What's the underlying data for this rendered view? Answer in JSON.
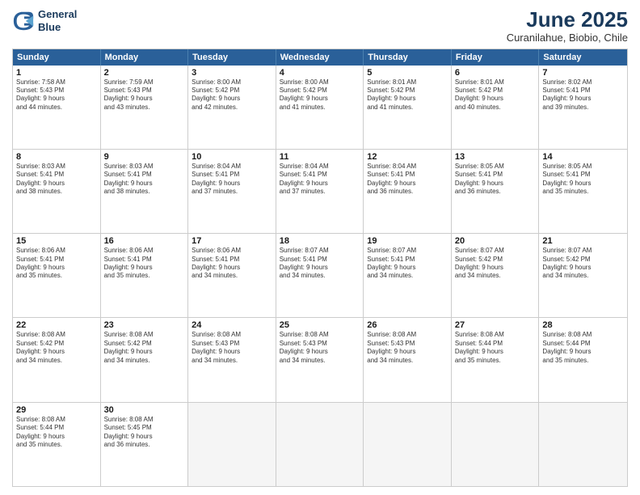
{
  "header": {
    "logo": {
      "line1": "General",
      "line2": "Blue"
    },
    "title": "June 2025",
    "subtitle": "Curanilahue, Biobio, Chile"
  },
  "days": [
    "Sunday",
    "Monday",
    "Tuesday",
    "Wednesday",
    "Thursday",
    "Friday",
    "Saturday"
  ],
  "rows": [
    [
      {
        "day": "1",
        "lines": [
          "Sunrise: 7:58 AM",
          "Sunset: 5:43 PM",
          "Daylight: 9 hours",
          "and 44 minutes."
        ]
      },
      {
        "day": "2",
        "lines": [
          "Sunrise: 7:59 AM",
          "Sunset: 5:43 PM",
          "Daylight: 9 hours",
          "and 43 minutes."
        ]
      },
      {
        "day": "3",
        "lines": [
          "Sunrise: 8:00 AM",
          "Sunset: 5:42 PM",
          "Daylight: 9 hours",
          "and 42 minutes."
        ]
      },
      {
        "day": "4",
        "lines": [
          "Sunrise: 8:00 AM",
          "Sunset: 5:42 PM",
          "Daylight: 9 hours",
          "and 41 minutes."
        ]
      },
      {
        "day": "5",
        "lines": [
          "Sunrise: 8:01 AM",
          "Sunset: 5:42 PM",
          "Daylight: 9 hours",
          "and 41 minutes."
        ]
      },
      {
        "day": "6",
        "lines": [
          "Sunrise: 8:01 AM",
          "Sunset: 5:42 PM",
          "Daylight: 9 hours",
          "and 40 minutes."
        ]
      },
      {
        "day": "7",
        "lines": [
          "Sunrise: 8:02 AM",
          "Sunset: 5:41 PM",
          "Daylight: 9 hours",
          "and 39 minutes."
        ]
      }
    ],
    [
      {
        "day": "8",
        "lines": [
          "Sunrise: 8:03 AM",
          "Sunset: 5:41 PM",
          "Daylight: 9 hours",
          "and 38 minutes."
        ]
      },
      {
        "day": "9",
        "lines": [
          "Sunrise: 8:03 AM",
          "Sunset: 5:41 PM",
          "Daylight: 9 hours",
          "and 38 minutes."
        ]
      },
      {
        "day": "10",
        "lines": [
          "Sunrise: 8:04 AM",
          "Sunset: 5:41 PM",
          "Daylight: 9 hours",
          "and 37 minutes."
        ]
      },
      {
        "day": "11",
        "lines": [
          "Sunrise: 8:04 AM",
          "Sunset: 5:41 PM",
          "Daylight: 9 hours",
          "and 37 minutes."
        ]
      },
      {
        "day": "12",
        "lines": [
          "Sunrise: 8:04 AM",
          "Sunset: 5:41 PM",
          "Daylight: 9 hours",
          "and 36 minutes."
        ]
      },
      {
        "day": "13",
        "lines": [
          "Sunrise: 8:05 AM",
          "Sunset: 5:41 PM",
          "Daylight: 9 hours",
          "and 36 minutes."
        ]
      },
      {
        "day": "14",
        "lines": [
          "Sunrise: 8:05 AM",
          "Sunset: 5:41 PM",
          "Daylight: 9 hours",
          "and 35 minutes."
        ]
      }
    ],
    [
      {
        "day": "15",
        "lines": [
          "Sunrise: 8:06 AM",
          "Sunset: 5:41 PM",
          "Daylight: 9 hours",
          "and 35 minutes."
        ]
      },
      {
        "day": "16",
        "lines": [
          "Sunrise: 8:06 AM",
          "Sunset: 5:41 PM",
          "Daylight: 9 hours",
          "and 35 minutes."
        ]
      },
      {
        "day": "17",
        "lines": [
          "Sunrise: 8:06 AM",
          "Sunset: 5:41 PM",
          "Daylight: 9 hours",
          "and 34 minutes."
        ]
      },
      {
        "day": "18",
        "lines": [
          "Sunrise: 8:07 AM",
          "Sunset: 5:41 PM",
          "Daylight: 9 hours",
          "and 34 minutes."
        ]
      },
      {
        "day": "19",
        "lines": [
          "Sunrise: 8:07 AM",
          "Sunset: 5:41 PM",
          "Daylight: 9 hours",
          "and 34 minutes."
        ]
      },
      {
        "day": "20",
        "lines": [
          "Sunrise: 8:07 AM",
          "Sunset: 5:42 PM",
          "Daylight: 9 hours",
          "and 34 minutes."
        ]
      },
      {
        "day": "21",
        "lines": [
          "Sunrise: 8:07 AM",
          "Sunset: 5:42 PM",
          "Daylight: 9 hours",
          "and 34 minutes."
        ]
      }
    ],
    [
      {
        "day": "22",
        "lines": [
          "Sunrise: 8:08 AM",
          "Sunset: 5:42 PM",
          "Daylight: 9 hours",
          "and 34 minutes."
        ]
      },
      {
        "day": "23",
        "lines": [
          "Sunrise: 8:08 AM",
          "Sunset: 5:42 PM",
          "Daylight: 9 hours",
          "and 34 minutes."
        ]
      },
      {
        "day": "24",
        "lines": [
          "Sunrise: 8:08 AM",
          "Sunset: 5:43 PM",
          "Daylight: 9 hours",
          "and 34 minutes."
        ]
      },
      {
        "day": "25",
        "lines": [
          "Sunrise: 8:08 AM",
          "Sunset: 5:43 PM",
          "Daylight: 9 hours",
          "and 34 minutes."
        ]
      },
      {
        "day": "26",
        "lines": [
          "Sunrise: 8:08 AM",
          "Sunset: 5:43 PM",
          "Daylight: 9 hours",
          "and 34 minutes."
        ]
      },
      {
        "day": "27",
        "lines": [
          "Sunrise: 8:08 AM",
          "Sunset: 5:44 PM",
          "Daylight: 9 hours",
          "and 35 minutes."
        ]
      },
      {
        "day": "28",
        "lines": [
          "Sunrise: 8:08 AM",
          "Sunset: 5:44 PM",
          "Daylight: 9 hours",
          "and 35 minutes."
        ]
      }
    ],
    [
      {
        "day": "29",
        "lines": [
          "Sunrise: 8:08 AM",
          "Sunset: 5:44 PM",
          "Daylight: 9 hours",
          "and 35 minutes."
        ]
      },
      {
        "day": "30",
        "lines": [
          "Sunrise: 8:08 AM",
          "Sunset: 5:45 PM",
          "Daylight: 9 hours",
          "and 36 minutes."
        ]
      },
      {
        "day": "",
        "lines": []
      },
      {
        "day": "",
        "lines": []
      },
      {
        "day": "",
        "lines": []
      },
      {
        "day": "",
        "lines": []
      },
      {
        "day": "",
        "lines": []
      }
    ]
  ]
}
